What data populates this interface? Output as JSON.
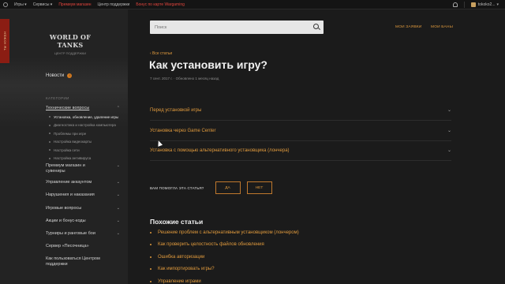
{
  "topbar": {
    "games": "Игры",
    "services": "Сервисы",
    "premium_shop": "Премиум магазин",
    "support_center": "Центр поддержки",
    "bonus": "Бонус по карте Wargaming",
    "username": "tokoko2..."
  },
  "ribbon": {
    "text": "ТЫ НУЖЕН"
  },
  "brand": {
    "logo": "WORLD OF TANKS",
    "subtitle": "ЦЕНТР ПОДДЕРЖКИ"
  },
  "sidebar": {
    "news": "Новости",
    "news_badge": "!",
    "categories_title": "КАТЕГОРИИ",
    "active_group": {
      "label": "Технические вопросы",
      "items": [
        "Установка, обновление, удаление игры",
        "Диагностика и настройка компьютера",
        "Проблемы при игре",
        "Настройка видеокарты",
        "Настройка сети",
        "Настройка антивируса"
      ]
    },
    "groups": [
      "Премиум магазин и сувениры",
      "Управление аккаунтом",
      "Нарушения и наказания",
      "Игровые вопросы",
      "Акции и бонус-коды",
      "Турниры и ранговые бои",
      "Сервер «Песочница»",
      "Как пользоваться Центром поддержки"
    ]
  },
  "header": {
    "search_placeholder": "Поиск",
    "my_requests": "МОИ ЗАЯВКИ",
    "my_bans": "МОИ БАНЫ"
  },
  "article": {
    "back": "‹ Все статьи",
    "title": "Как установить игру?",
    "meta": "7 сент. 2017 г. · Обновлено 1 месяц назад",
    "sections": [
      "Перед установкой игры",
      "Установка через Game Center",
      "Установка с помощью альтернативного установщика (лончера)"
    ]
  },
  "feedback": {
    "question": "ВАМ ПОМОГЛА ЭТА СТАТЬЯ?",
    "yes": "ДА",
    "no": "НЕТ"
  },
  "similar": {
    "title": "Похожие статьи",
    "items": [
      "Решение проблем с альтернативным установщиком (лончером)",
      "Как проверить целостность файлов обновления",
      "Ошибка авторизации",
      "Как импортировать игры?",
      "Управление играми"
    ]
  },
  "colors": {
    "accent": "#e09a3d",
    "ribbon": "#8b1d13",
    "background": "#1b1b1b",
    "sidebar": "#232323"
  }
}
